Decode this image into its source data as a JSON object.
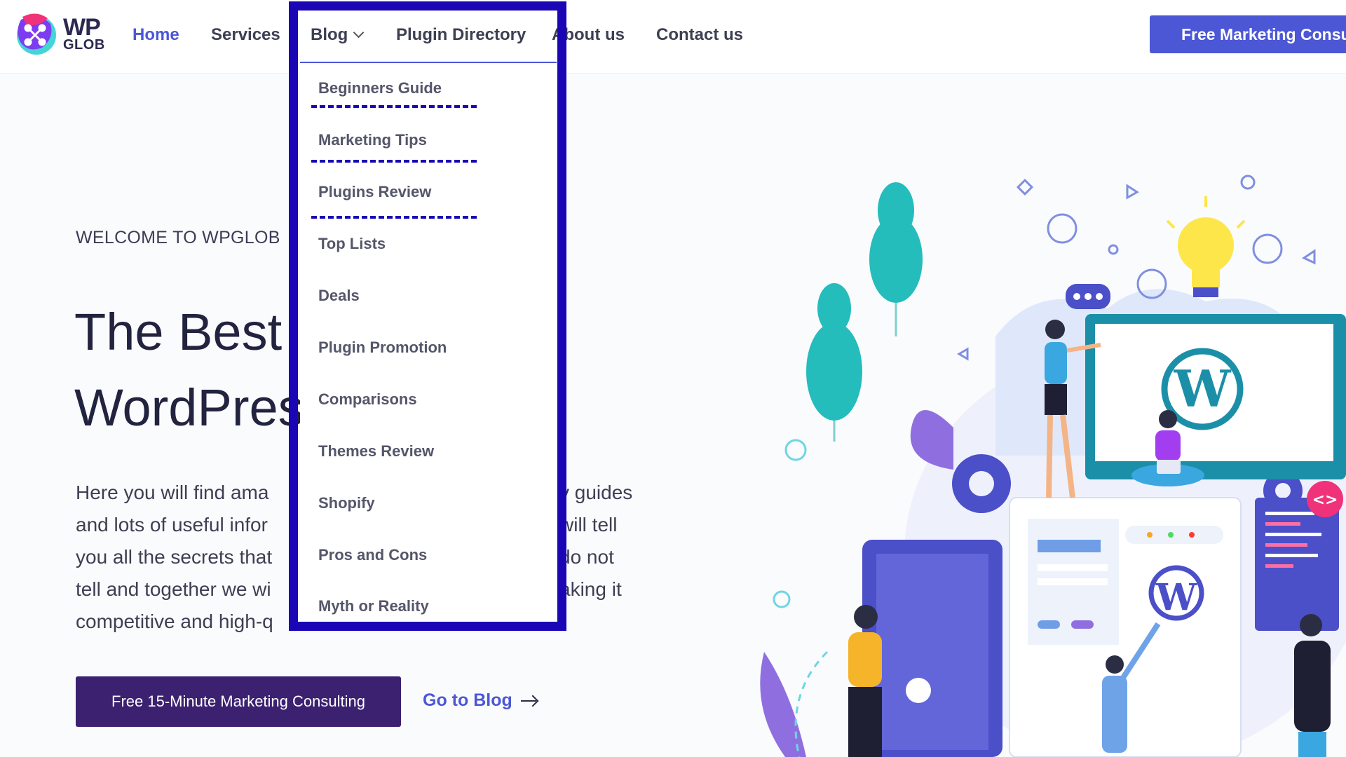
{
  "brand": {
    "wp": "WP",
    "glob": "GLOB"
  },
  "nav": {
    "home": "Home",
    "services": "Services",
    "blog": "Blog",
    "plugin_directory": "Plugin Directory",
    "about": "About us",
    "contact": "Contact us",
    "cta": "Free Marketing Consu"
  },
  "dropdown": {
    "items": [
      "Beginners Guide",
      "Marketing Tips",
      "Plugins Review",
      "Top Lists",
      "Deals",
      "Plugin Promotion",
      "Comparisons",
      "Themes Review",
      "Shopify",
      "Pros and Cons",
      "Myth or Reality"
    ]
  },
  "hero": {
    "welcome": "WELCOME TO WPGLOB",
    "title_line1": "The Best",
    "title_line2": "WordPres",
    "body_left": [
      "Here you will find ama",
      "and lots of useful infor",
      "you all the secrets that",
      "tell and together we wi",
      "competitive and high-q"
    ],
    "body_right": [
      "y guides",
      "will tell",
      "do not",
      "aking it",
      ""
    ],
    "consult_button": "Free 15-Minute Marketing Consulting",
    "blog_link": "Go to Blog"
  },
  "colors": {
    "accent": "#4c57d6",
    "highlight_border": "#1a06b5",
    "dark_button": "#3b2170",
    "teal": "#26c0c0"
  }
}
